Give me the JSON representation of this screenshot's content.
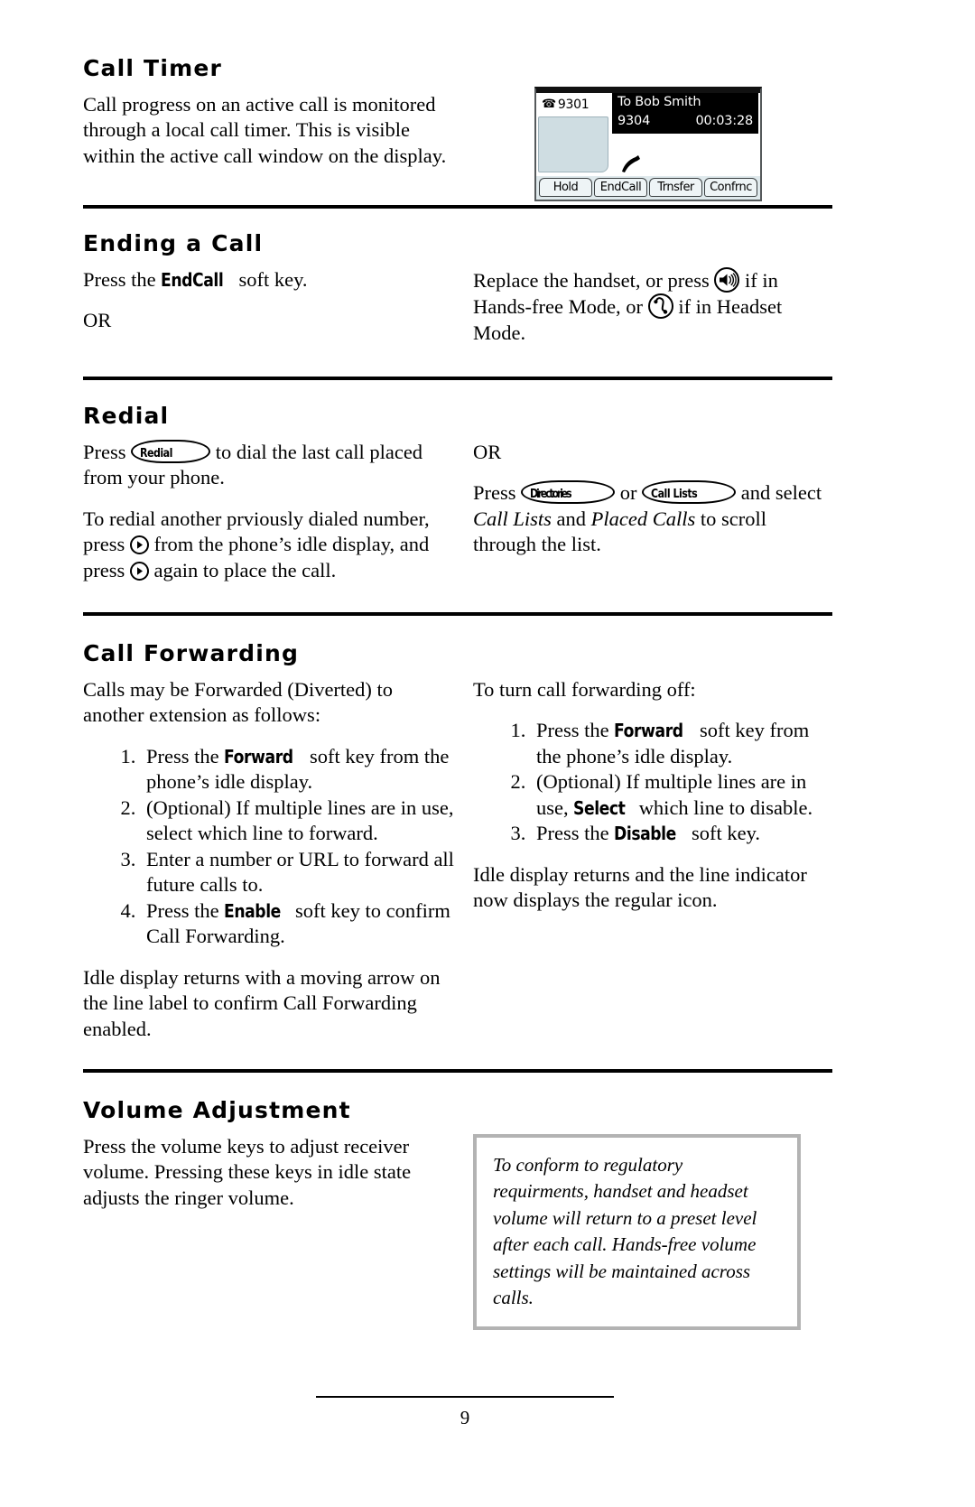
{
  "page": {
    "number": "9"
  },
  "sections": [
    {
      "id": "call-timer",
      "title": "Call Timer",
      "left_paragraphs": [
        "Call progress on an active call is monitored through a local call timer.  This is visible within the active call window on the display."
      ]
    },
    {
      "id": "ending-a-call",
      "title": "Ending a Call",
      "left_paragraphs": [
        "Press the ",
        " soft key.",
        "OR"
      ],
      "left_softkey": "EndCall",
      "right_text_parts": [
        "Replace the handset, or press ",
        " if in Hands-free Mode, or ",
        " if in Headset Mode."
      ]
    },
    {
      "id": "redial",
      "title": "Redial",
      "left_p1_a": "Press ",
      "left_p1_b": " to dial the last call placed from your phone.",
      "left_p2_a": "To redial another prviously dialed number, press ",
      "left_p2_b": " from the phone’s idle display, and press ",
      "left_p2_c": " again to place the call.",
      "right_or": "OR",
      "right_a": "Press ",
      "right_b": " or ",
      "right_c": " and select ",
      "right_italic_1": "Call Lists",
      "right_d": " and ",
      "right_italic_2": "Placed Calls",
      "right_e": " to scroll through the list."
    },
    {
      "id": "call-forwarding",
      "title": "Call Forwarding",
      "left_intro": "Calls may be Forwarded (Diverted) to another extension as follows:",
      "left_steps": [
        {
          "pre": "Press the ",
          "key": "Forward",
          "post": " soft key from the phone’s idle display."
        },
        {
          "pre": "(Optional) If multiple lines are in use, select which line to forward.",
          "key": "",
          "post": ""
        },
        {
          "pre": "Enter a number or URL to forward all future calls to.",
          "key": "",
          "post": ""
        },
        {
          "pre": "Press the ",
          "key": "Enable",
          "post": " soft key to confirm Call Forwarding."
        }
      ],
      "left_outro": "Idle display returns with a moving arrow on the line label to confirm Call Forwarding enabled.",
      "right_intro": "To turn call forwarding off:",
      "right_steps": [
        {
          "pre": "Press the ",
          "key": "Forward",
          "post": " soft key from the phone’s idle display."
        },
        {
          "pre": "(Optional) If multiple lines are in use, ",
          "key": "Select",
          "post": " which line to disable."
        },
        {
          "pre": "Press the ",
          "key": "Disable",
          "post": " soft key."
        }
      ],
      "right_outro": "Idle display returns and the line indicator now displays the regular icon."
    },
    {
      "id": "volume-adjustment",
      "title": "Volume Adjustment",
      "left_paragraphs": [
        "Press the volume keys to adjust receiver volume.  Pressing these keys in idle state adjusts the ringer volume."
      ],
      "note": "To conform to regulatory requirments, handset and headset volume will return to a preset level after each call.  Hands-free volume settings will be maintained across calls."
    }
  ],
  "phone_display": {
    "line_label": "9301",
    "telephone_glyph": "☎",
    "call_to": "To Bob Smith",
    "call_number": "9304",
    "call_timer": "00:03:28",
    "soft_keys": [
      "Hold",
      "EndCall",
      "Trnsfer",
      "Confrnc"
    ]
  },
  "hard_keys": {
    "redial": "Redial",
    "directories": "Directories",
    "call_lists": "Call Lists"
  },
  "icons": {
    "speaker": "speaker-icon",
    "headset": "headset-icon",
    "right_arrow": "right-arrow-icon"
  },
  "colors": {
    "rule": "#000000",
    "note_border": "#b3b3b3",
    "phone_panel": "#cfdde2",
    "phone_softrow": "#dfe9ec",
    "phone_callbox": "#000000"
  }
}
